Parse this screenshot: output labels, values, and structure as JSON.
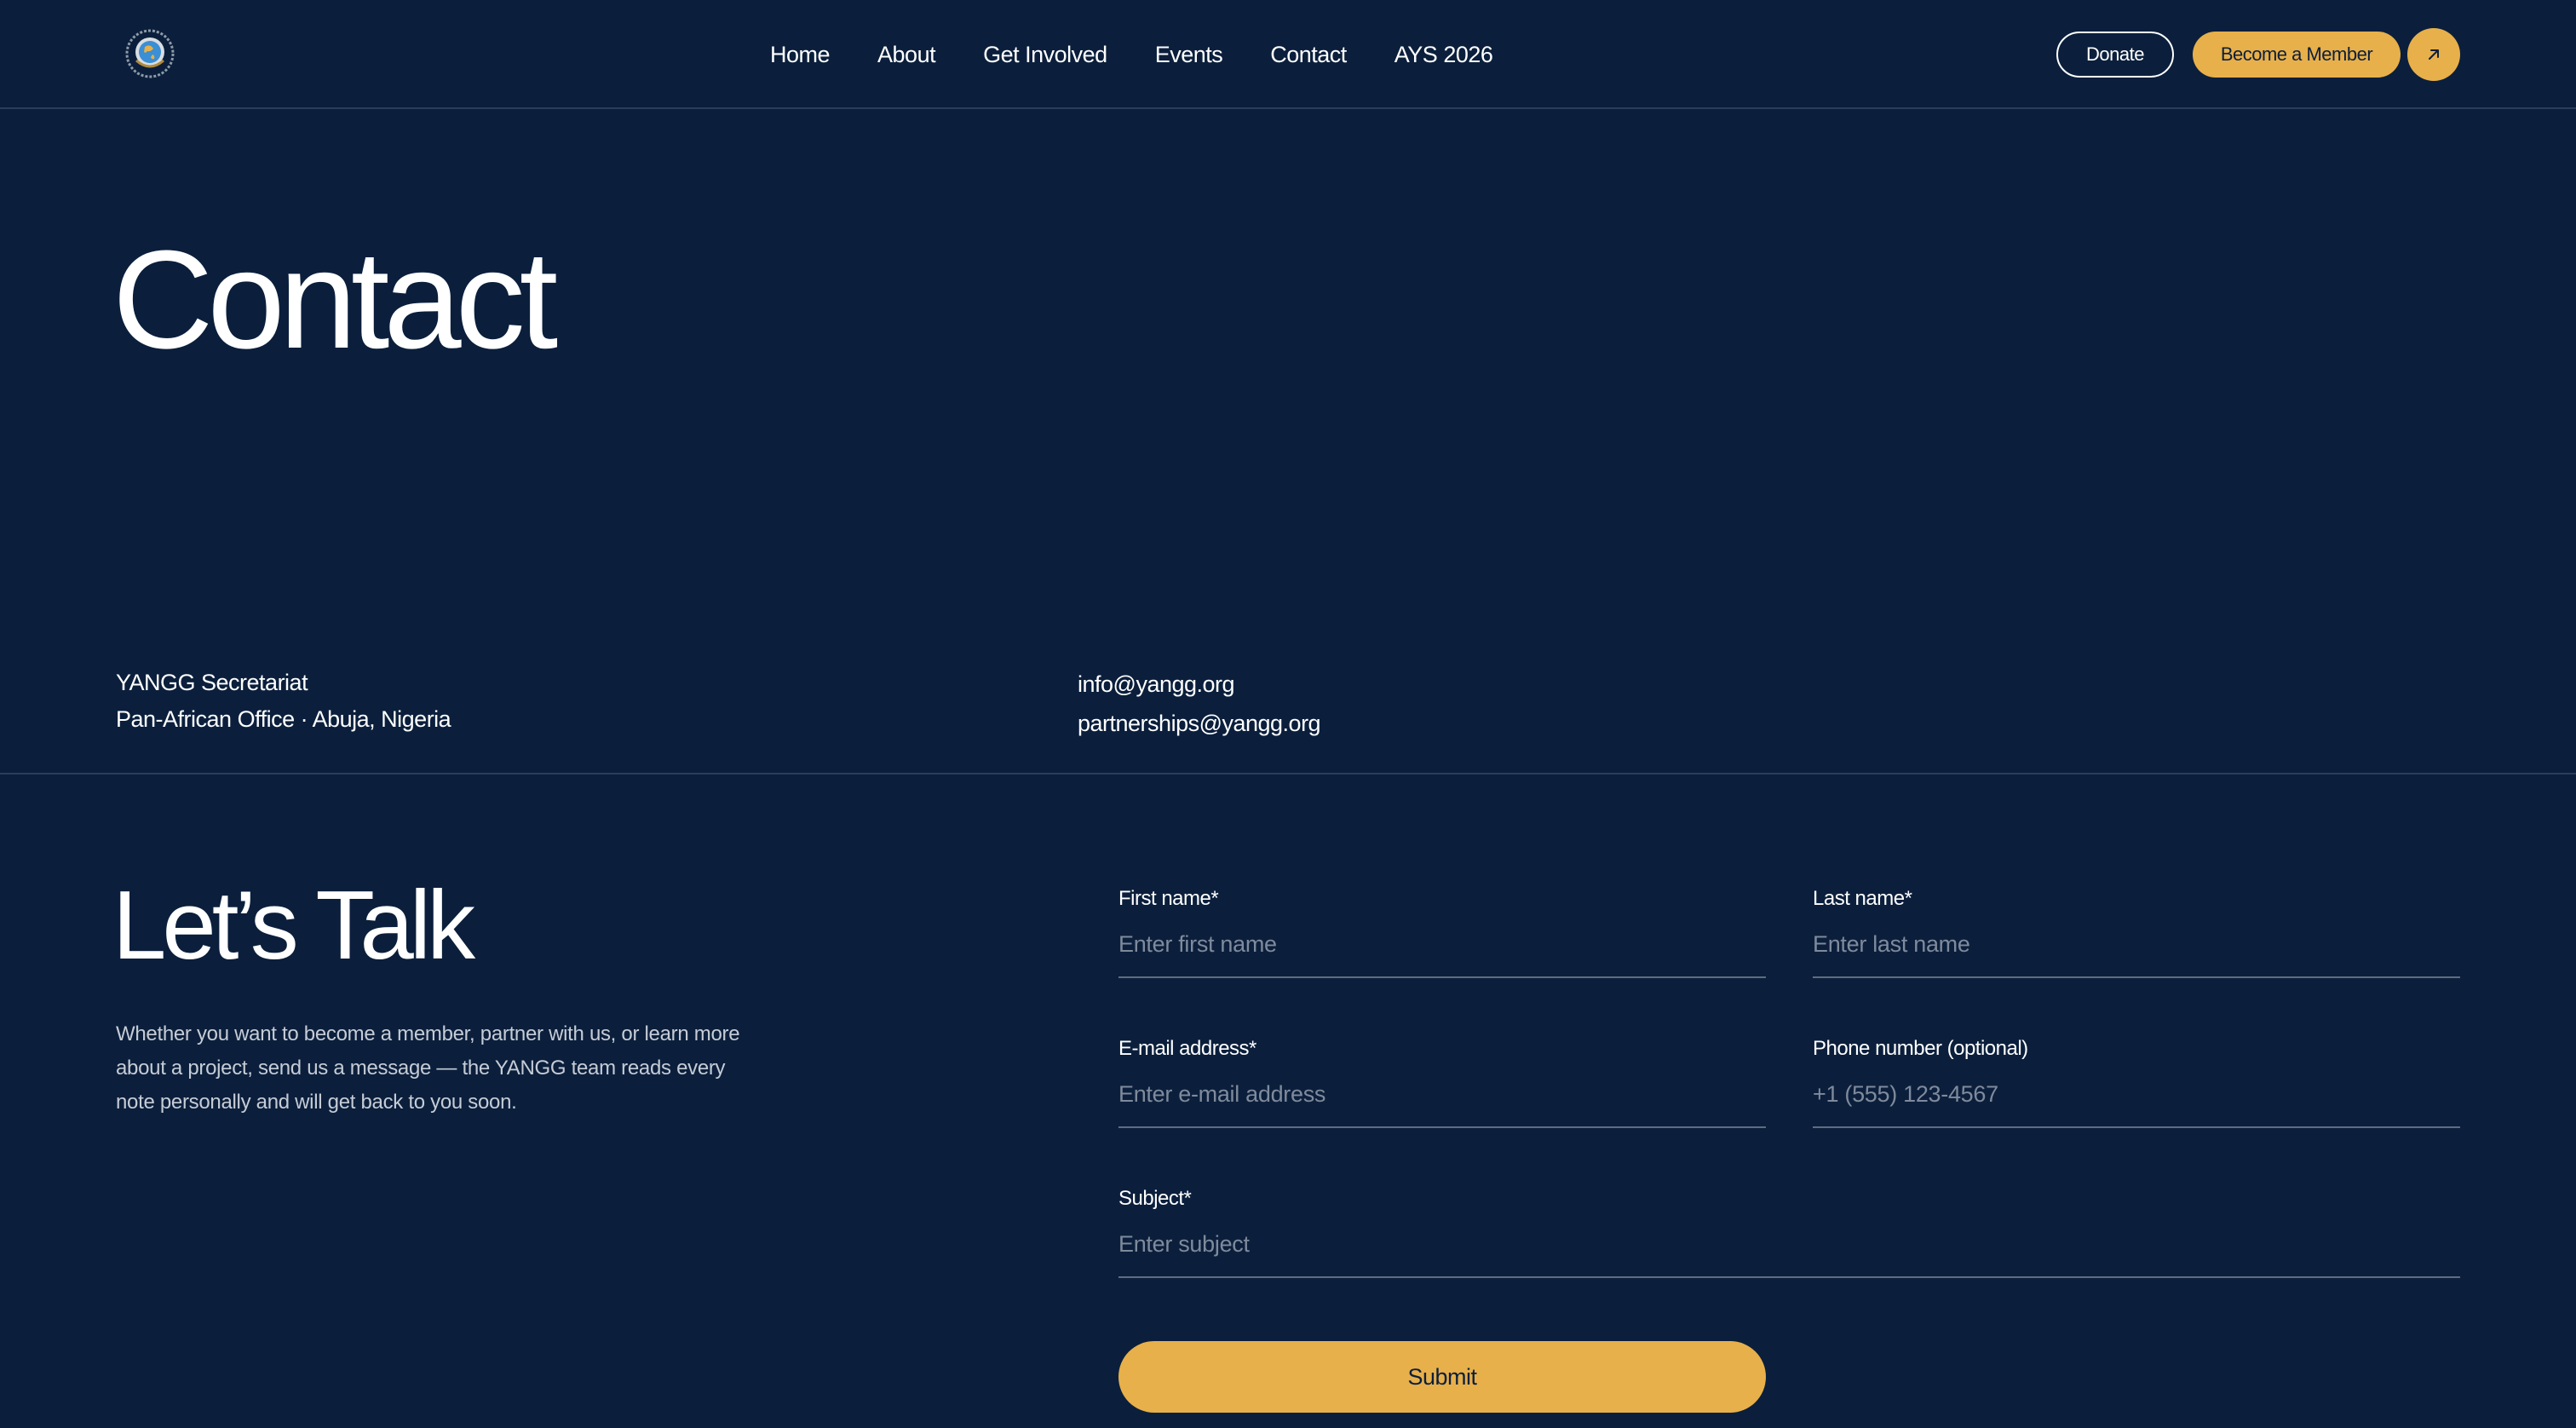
{
  "header": {
    "nav": [
      "Home",
      "About",
      "Get Involved",
      "Events",
      "Contact",
      "AYS 2026"
    ],
    "donate_label": "Donate",
    "member_label": "Become a Member",
    "arrow_icon": "arrow-up-right-icon",
    "logo_icon": "globe-laurel-emblem-icon"
  },
  "hero": {
    "title": "Contact",
    "address_line1": "YANGG Secretariat",
    "address_line2": "Pan-African Office · Abuja, Nigeria",
    "email_general": "info@yangg.org",
    "email_partnerships": "partnerships@yangg.org"
  },
  "talk": {
    "title": "Let’s Talk",
    "description": "Whether you want to become a member, partner with us, or learn more about a project, send us a message — the YANGG team reads every note personally and will get back to you soon."
  },
  "form": {
    "first_name": {
      "label": "First name*",
      "placeholder": "Enter first name"
    },
    "last_name": {
      "label": "Last name*",
      "placeholder": "Enter last name"
    },
    "email": {
      "label": "E-mail address*",
      "placeholder": "Enter e-mail address"
    },
    "phone": {
      "label": "Phone number (optional)",
      "placeholder": "+1 (555) 123-4567"
    },
    "subject": {
      "label": "Subject*",
      "placeholder": "Enter subject"
    },
    "submit_label": "Submit"
  },
  "colors": {
    "background": "#0b1f3c",
    "accent": "#e8b04a",
    "divider": "#2a3d5a"
  }
}
